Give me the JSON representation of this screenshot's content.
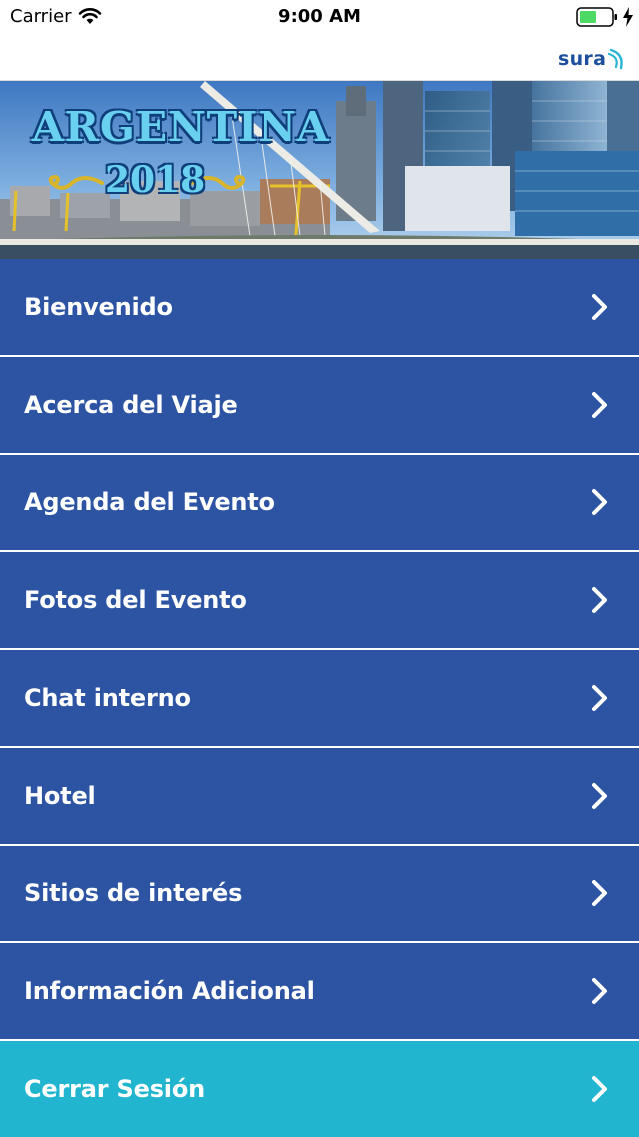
{
  "status_bar": {
    "carrier": "Carrier",
    "time": "9:00 AM"
  },
  "brand": {
    "logo_text": "sura",
    "color": "#1d4f9e"
  },
  "banner": {
    "title": "ARGENTINA",
    "year": "2018"
  },
  "menu": {
    "items": [
      {
        "label": "Bienvenido"
      },
      {
        "label": "Acerca del Viaje"
      },
      {
        "label": "Agenda del Evento"
      },
      {
        "label": "Fotos del Evento"
      },
      {
        "label": "Chat interno"
      },
      {
        "label": "Hotel"
      },
      {
        "label": "Sitios de interés"
      },
      {
        "label": "Información Adicional"
      }
    ],
    "logout": {
      "label": "Cerrar Sesión"
    },
    "item_color": "#2d54a3",
    "logout_color": "#22b5cf"
  }
}
